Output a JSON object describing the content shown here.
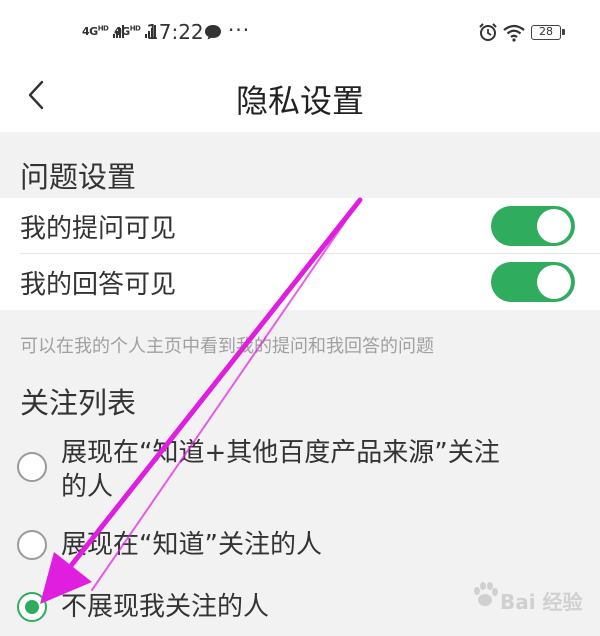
{
  "status_bar": {
    "signal_1": "4G",
    "signal_1_sup": "HD",
    "signal_2": "4G",
    "signal_2_sup": "HD",
    "time": "17:22",
    "more": "···",
    "battery": "28"
  },
  "nav": {
    "title": "隐私设置",
    "back_icon": "chevron-left-icon"
  },
  "question_settings": {
    "title": "问题设置",
    "items": [
      {
        "label": "我的提问可见",
        "enabled": true
      },
      {
        "label": "我的回答可见",
        "enabled": true
      }
    ],
    "hint": "可以在我的个人主页中看到我的提问和我回答的问题"
  },
  "follow_list": {
    "title": "关注列表",
    "options": [
      {
        "label_line1": "展现在“知道+其他百度产品来源”关注",
        "label_line2": "的人",
        "selected": false
      },
      {
        "label_line1": "展现在“知道”关注的人",
        "label_line2": "",
        "selected": false
      },
      {
        "label_line1": "不展现我关注的人",
        "label_line2": "",
        "selected": true
      }
    ]
  },
  "watermark": {
    "text": "Bai 经验",
    "icon": "paw-icon"
  },
  "colors": {
    "accent_green": "#2fac5d",
    "arrow_magenta": "#e01ee0",
    "section_bg": "#f2f2f2"
  }
}
